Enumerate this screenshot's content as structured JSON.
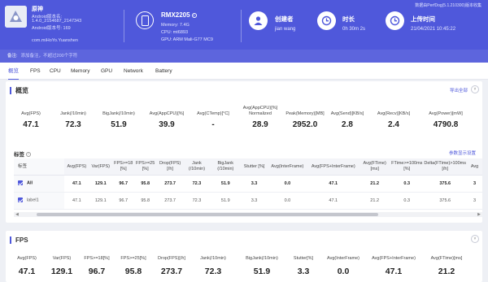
{
  "app": {
    "name": "原神",
    "lines": [
      "Android版本名:",
      "1.4.0_2154687_2147343",
      "Android版本号: 169",
      "com.miHoYo.Yuanshen"
    ]
  },
  "device": {
    "name": "RMX2205",
    "lines": [
      "Memory: 7.4G",
      "CPU: mt6893",
      "GPU: ARM Mali-G77 MC9"
    ]
  },
  "creator": {
    "label": "创建者",
    "value": "jian wang"
  },
  "duration": {
    "label": "时长",
    "value": "0h 30m 2s"
  },
  "upload": {
    "label": "上传时间",
    "value": "21/04/2021 10:45:22"
  },
  "perfdog_note": "数据由PerfDog(5.1.210300)版本收集",
  "note_bar": {
    "label": "备注:",
    "placeholder": "添加备注，不超过200个字符"
  },
  "tabs": [
    "概览",
    "FPS",
    "CPU",
    "Memory",
    "GPU",
    "Network",
    "Battery"
  ],
  "overview": {
    "title": "概览",
    "export_label": "导出全部",
    "collapse_label": "˅",
    "metrics": [
      {
        "label": "Avg(FPS)",
        "value": "47.1"
      },
      {
        "label": "Jank(/10min)",
        "value": "72.3"
      },
      {
        "label": "BigJank(/10min)",
        "value": "51.9"
      },
      {
        "label": "Avg(AppCPU)[%]",
        "value": "39.9"
      },
      {
        "label": "Avg(CTemp)[°C]",
        "value": "-"
      },
      {
        "label": "Avg(AppCPU)[%] Normalized",
        "value": "28.9"
      },
      {
        "label": "Peak(Memory)[MB]",
        "value": "2952.0"
      },
      {
        "label": "Avg(Send)[KB/s]",
        "value": "2.8"
      },
      {
        "label": "Avg(Recv)[KB/s]",
        "value": "2.4"
      },
      {
        "label": "Avg(Power)[mW]",
        "value": "4790.8"
      }
    ],
    "label_section": "标签",
    "param_link": "参数显示设置",
    "table": {
      "headers": [
        "标签",
        "Avg(FPS)",
        "Var(FPS)",
        "FPS>=18 [%]",
        "FPS>=25 [%]",
        "Drop(FPS) [/h]",
        "Jank (/10min)",
        "BigJank (/10min)",
        "Stutter [%]",
        "Avg(InterFrame)",
        "Avg(FPS+InterFrame)",
        "Avg(FTime) [ms]",
        "FTime>=100ms [%]",
        "Delta(FTime)>100ms [/h]",
        "Avg"
      ],
      "rows": [
        {
          "label": "All",
          "cells": [
            "47.1",
            "129.1",
            "96.7",
            "95.8",
            "273.7",
            "72.3",
            "51.9",
            "3.3",
            "0.0",
            "47.1",
            "21.2",
            "0.3",
            "375.6",
            "3"
          ]
        },
        {
          "label": "label1",
          "cells": [
            "47.1",
            "129.1",
            "96.7",
            "95.8",
            "273.7",
            "72.3",
            "51.9",
            "3.3",
            "0.0",
            "47.1",
            "21.2",
            "0.3",
            "375.6",
            "3"
          ]
        }
      ]
    }
  },
  "fps_card": {
    "title": "FPS",
    "collapse_label": "˅",
    "metrics": [
      {
        "label": "Avg(FPS)",
        "value": "47.1"
      },
      {
        "label": "Var(FPS)",
        "value": "129.1"
      },
      {
        "label": "FPS>=18[%]",
        "value": "96.7"
      },
      {
        "label": "FPS>=25[%]",
        "value": "95.8"
      },
      {
        "label": "Drop(FPS)[/h]",
        "value": "273.7"
      },
      {
        "label": "Jank(/10min)",
        "value": "72.3"
      },
      {
        "label": "BigJank(/10min)",
        "value": "51.9"
      },
      {
        "label": "Stutter[%]",
        "value": "3.3"
      },
      {
        "label": "Avg(InterFrame)",
        "value": "0.0"
      },
      {
        "label": "Avg(FPS+InterFrame)",
        "value": "47.1"
      },
      {
        "label": "Avg(FTime)[ms]",
        "value": "21.2"
      }
    ]
  },
  "colors": {
    "accent": "#4f58db",
    "header_bg": "#4f58db"
  }
}
